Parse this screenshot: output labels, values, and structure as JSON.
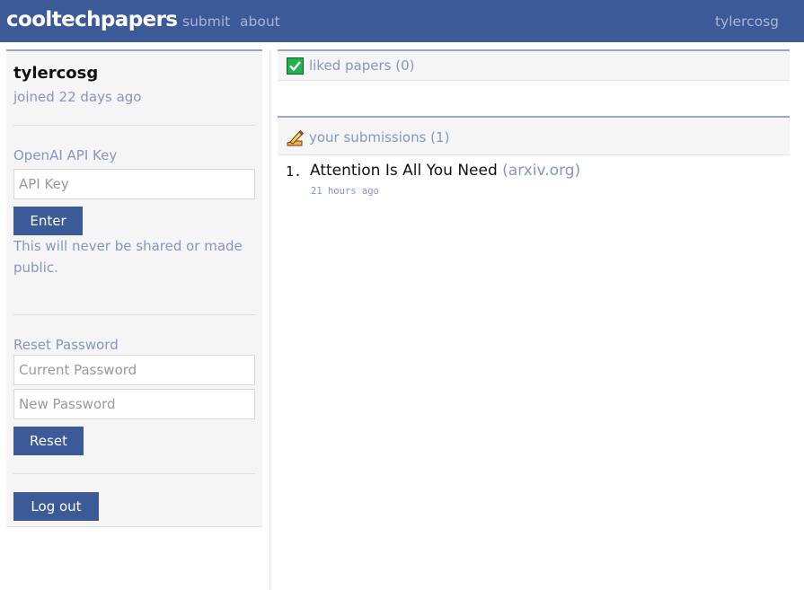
{
  "navbar": {
    "brand": "cooltechpapers",
    "links": [
      "submit",
      "about"
    ],
    "user": "tylercosg",
    "background": "#3c5a98"
  },
  "profile": {
    "username": "tylercosg",
    "joined": "joined 22 days ago"
  },
  "api_key": {
    "label": "OpenAI API Key",
    "placeholder": "API Key",
    "button": "Enter",
    "note": "This will never be shared or made public."
  },
  "reset_password": {
    "label": "Reset Password",
    "current_placeholder": "Current Password",
    "new_placeholder": "New Password",
    "button": "Reset"
  },
  "logout": {
    "button": "Log out"
  },
  "liked": {
    "title": "liked papers (0)",
    "icon": "checkmark-icon"
  },
  "submissions": {
    "title": "your submissions (1)",
    "icon": "pencil-icon",
    "items": [
      {
        "number": "1.",
        "title": "Attention Is All You Need",
        "domain": "(arxiv.org)",
        "time": "21 hours ago"
      }
    ]
  }
}
